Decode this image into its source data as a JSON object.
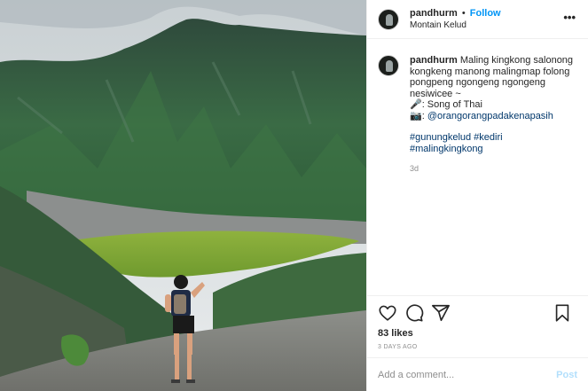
{
  "header": {
    "username": "pandhurm",
    "separator": "•",
    "follow_label": "Follow",
    "location": "Montain Kelud",
    "more_icon": "more-horizontal-icon"
  },
  "caption": {
    "username": "pandhurm",
    "text": "Maling kingkong salonong kongkeng manong malingmap folong pongpeng ngongeng ngongeng nesiwicee ~",
    "music_line": "🎤: Song of Thai",
    "photo_prefix": "📷: ",
    "photo_mention": "@orangorangpadakenapasih",
    "hashtags_line1": "#gunungkelud #kediri",
    "hashtags_line2": "#malingkingkong",
    "age": "3d"
  },
  "actions": {
    "icons": [
      "heart-icon",
      "comment-icon",
      "share-icon",
      "bookmark-icon"
    ],
    "likes": "83 likes",
    "timestamp": "3 DAYS AGO"
  },
  "comment": {
    "placeholder": "Add a comment...",
    "post_label": "Post"
  },
  "colors": {
    "accent": "#0095f6",
    "link": "#00376b",
    "muted": "#8e8e8e",
    "post_disabled": "#b2dffc"
  }
}
